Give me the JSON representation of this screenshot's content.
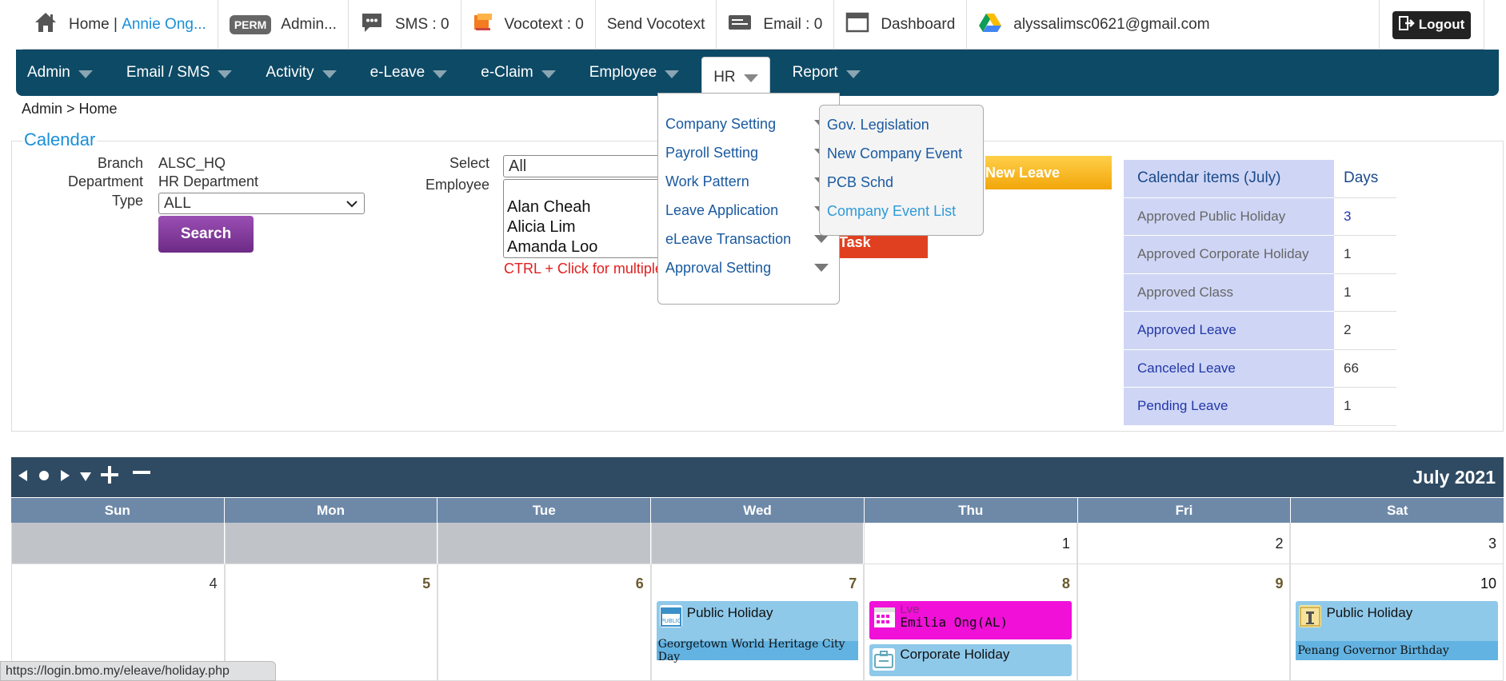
{
  "topbar": {
    "home_label": "Home | ",
    "user_name": "Annie Ong...",
    "perm_badge": "PERM",
    "admin_label": "Admin...",
    "sms_label": "SMS : 0",
    "vocotext_label": "Vocotext : 0",
    "send_vocotext_label": "Send Vocotext",
    "email_label": "Email : 0",
    "dashboard_label": "Dashboard",
    "account_email": "alyssalimsc0621@gmail.com",
    "logout_label": "Logout"
  },
  "nav": {
    "items": [
      "Admin",
      "Email / SMS",
      "Activity",
      "e-Leave",
      "e-Claim",
      "Employee",
      "HR",
      "Report"
    ]
  },
  "breadcrumb": "Admin > Home",
  "calendar_panel": {
    "legend": "Calendar",
    "branch_label": "Branch",
    "branch_value": "ALSC_HQ",
    "department_label": "Department",
    "department_value": "HR Department",
    "type_label": "Type",
    "type_value": "ALL",
    "search_button": "Search",
    "select_label": "Select",
    "employee_label": "Employee",
    "employee_select_value": "All",
    "employees": [
      "Alan Cheah",
      "Alicia Lim",
      "Amanda Loo"
    ],
    "ctrl_note": "CTRL + Click for multiple",
    "new_leave_button": "New Leave",
    "task_button": "Task"
  },
  "calendar_items": {
    "header": "Calendar items (July)",
    "days_header": "Days",
    "rows": [
      {
        "label": "Approved Public Holiday",
        "days": "3"
      },
      {
        "label": "Approved Corporate Holiday",
        "days": "1"
      },
      {
        "label": "Approved Class",
        "days": "1"
      },
      {
        "label": "Approved Leave",
        "days": "2"
      },
      {
        "label": "Canceled Leave",
        "days": "66"
      },
      {
        "label": "Pending Leave",
        "days": "1"
      }
    ]
  },
  "hr_menu": {
    "items": [
      "Company Setting",
      "Payroll Setting",
      "Work Pattern",
      "Leave Application",
      "eLeave Transaction",
      "Approval Setting"
    ],
    "submenu": [
      "Gov. Legislation",
      "New Company Event",
      "PCB Schd",
      "Company Event List"
    ]
  },
  "calendar": {
    "month": "July 2021",
    "weekdays": [
      "Sun",
      "Mon",
      "Tue",
      "Wed",
      "Thu",
      "Fri",
      "Sat"
    ],
    "week1": [
      "",
      "",
      "",
      "",
      "1",
      "2",
      "3"
    ],
    "week2": [
      "4",
      "5",
      "6",
      "7",
      "8",
      "9",
      "10"
    ],
    "events": {
      "wed7_title": "Public Holiday",
      "wed7_sub": "Georgetown World Heritage City Day",
      "thu8_type": "Lve",
      "thu8_title": "Emilia Ong(AL)",
      "thu8_corp": "Corporate Holiday",
      "sat10_title": "Public Holiday",
      "sat10_sub": "Penang Governor Birthday",
      "public_icon_text": "PUBLIC"
    }
  },
  "status_url": "https://login.bmo.my/eleave/holiday.php",
  "colors": {
    "nav_bg": "#0d4a66",
    "cal_head": "#2f4b63",
    "dow_bg": "#6e89a8",
    "items_bg": "#cfd6f5",
    "search_btn": "#7a3494",
    "new_leave_btn": "#f2a60a",
    "task_btn": "#e04020",
    "leave_event": "#f010d8",
    "holiday_event": "#8ec9ea"
  }
}
